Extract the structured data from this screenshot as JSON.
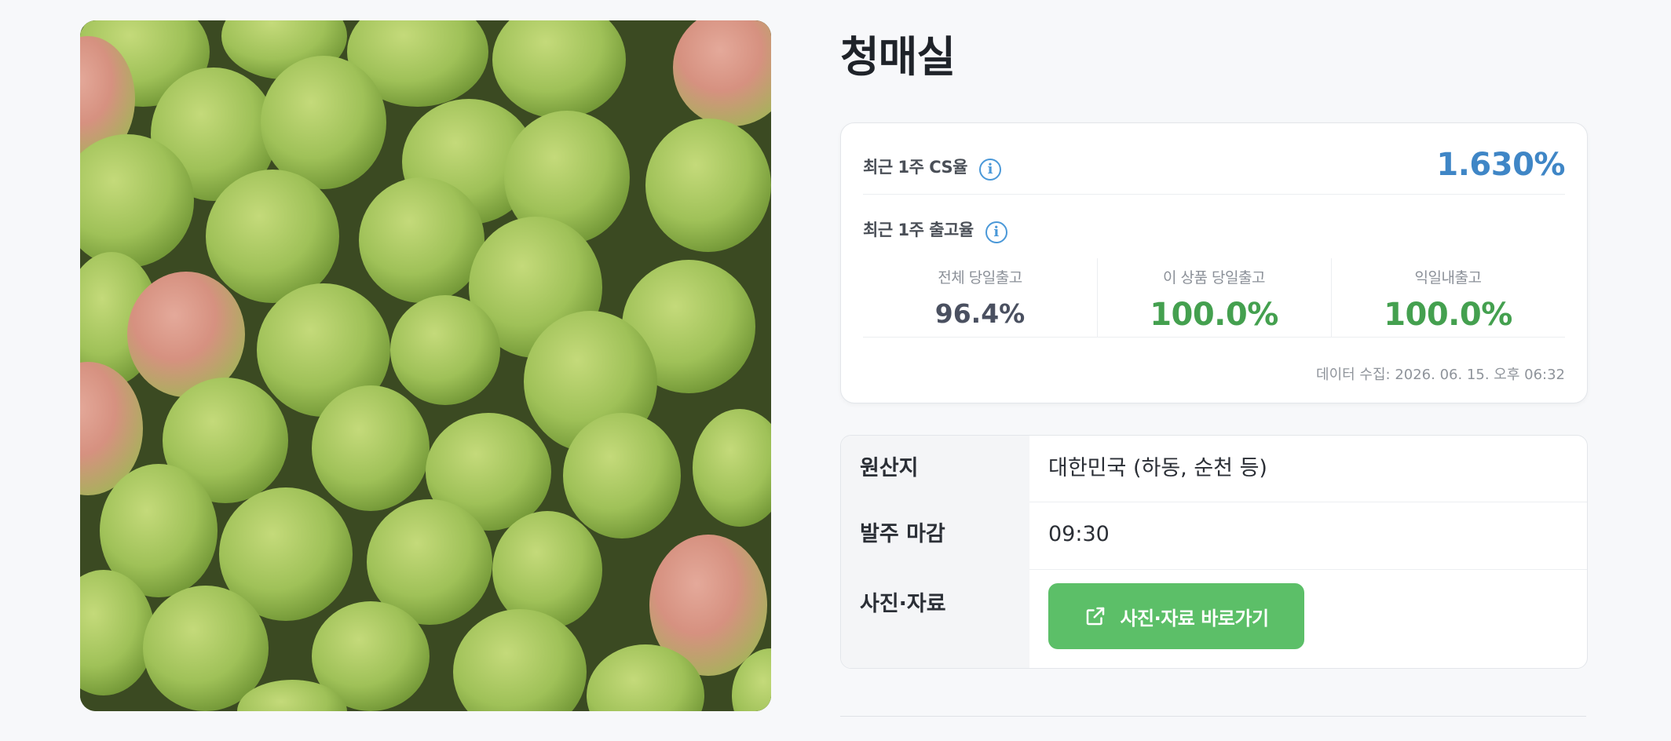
{
  "product": {
    "title": "청매실",
    "image_alt": "green plums photo"
  },
  "stats": {
    "cs_label": "최근 1주 CS율",
    "cs_value": "1.630%",
    "shipping_label": "최근 1주 출고율",
    "columns": [
      {
        "label": "전체 당일출고",
        "value": "96.4%"
      },
      {
        "label": "이 상품 당일출고",
        "value": "100.0%"
      },
      {
        "label": "익일내출고",
        "value": "100.0%"
      }
    ],
    "collected_at": "데이터 수집: 2026. 06. 15. 오후 06:32"
  },
  "info": {
    "origin_label": "원산지",
    "origin_value": "대한민국 (하동, 순천 등)",
    "deadline_label": "발주 마감",
    "deadline_value": "09:30",
    "media_label": "사진·자료",
    "media_button": "사진·자료 바로가기"
  },
  "colors": {
    "accent_blue": "#3f86c6",
    "accent_green": "#44a04f",
    "button_green": "#5cbf68"
  },
  "icons": [
    "info-icon",
    "external-link-icon"
  ]
}
